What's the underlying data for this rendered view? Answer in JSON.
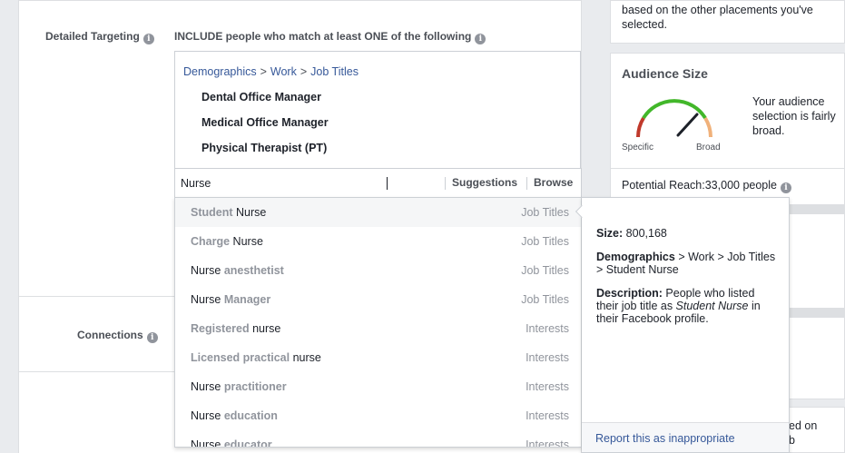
{
  "targeting": {
    "label": "Detailed Targeting",
    "include_text": "INCLUDE people who match at least ONE of the following",
    "breadcrumb": [
      "Demographics",
      "Work",
      "Job Titles"
    ],
    "selected": [
      "Dental Office Manager",
      "Medical Office Manager",
      "Physical Therapist (PT)"
    ],
    "search_value": "Nurse",
    "suggestions_label": "Suggestions",
    "browse_label": "Browse"
  },
  "connections_label": "Connections",
  "dropdown": [
    {
      "pre": "Student ",
      "match": "Nurse",
      "post": "",
      "type": "Job Titles"
    },
    {
      "pre": "Charge ",
      "match": "Nurse",
      "post": "",
      "type": "Job Titles"
    },
    {
      "pre": "",
      "match": "Nurse",
      "post": " anesthetist",
      "type": "Job Titles"
    },
    {
      "pre": "",
      "match": "Nurse",
      "post": " Manager",
      "type": "Job Titles"
    },
    {
      "pre": "Registered ",
      "match": "nurse",
      "post": "",
      "type": "Interests"
    },
    {
      "pre": "Licensed practical ",
      "match": "nurse",
      "post": "",
      "type": "Interests"
    },
    {
      "pre": "",
      "match": "Nurse",
      "post": " practitioner",
      "type": "Interests"
    },
    {
      "pre": "",
      "match": "Nurse",
      "post": " education",
      "type": "Interests"
    },
    {
      "pre": "",
      "match": "Nurse",
      "post": " educator",
      "type": "Interests"
    }
  ],
  "detail": {
    "size_label": "Size:",
    "size_value": "800,168",
    "demo_label": "Demographics",
    "demo_path": " > Work > Job Titles > Student Nurse",
    "desc_label": "Description:",
    "desc_pre": " People who listed their job title as ",
    "desc_em": "Student Nurse",
    "desc_post": " in their Facebook profile.",
    "report_link": "Report this as inappropriate"
  },
  "side": {
    "top_text": "based on the other placements you've selected.",
    "audience_title": "Audience Size",
    "audience_text": "Your audience selection is fairly broad.",
    "gauge_specific": "Specific",
    "gauge_broad": "Broad",
    "reach_label": "Potential Reach:",
    "reach_value": "33,000 people",
    "bottom_text_1": "ed on",
    "bottom_text_2": "b"
  },
  "colors": {
    "link": "#365899",
    "gauge_red": "#c0392b",
    "gauge_green": "#42b72a",
    "gauge_orange": "#f0b17a"
  }
}
